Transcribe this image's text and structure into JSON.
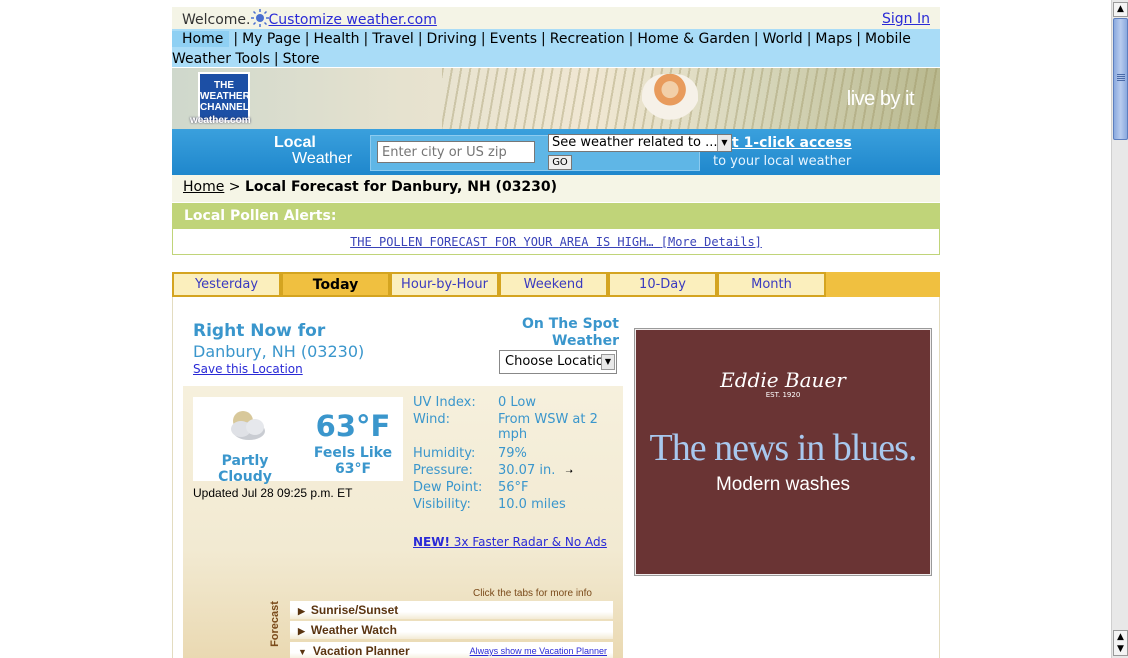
{
  "welcome": {
    "text": "Welcome.",
    "customize_link": "Customize weather.com",
    "sign_in": "Sign In"
  },
  "nav": {
    "row1": [
      "Home",
      "My Page",
      "Health",
      "Travel",
      "Driving",
      "Events",
      "Recreation",
      "Home & Garden",
      "World",
      "Maps",
      "Mobile"
    ],
    "row2": [
      "Weather Tools",
      "Store"
    ]
  },
  "banner": {
    "logo_lines": [
      "THE",
      "WEATHER",
      "CHANNEL"
    ],
    "logo_caption": "weather.com",
    "tagline": "live by it"
  },
  "local": {
    "title": "Local",
    "title2": "Weather",
    "city_placeholder": "Enter city or US zip",
    "related_select": "See weather related to ...",
    "go": "GO",
    "access_link": "t 1-click access",
    "access_sub": "to your local weather"
  },
  "breadcrumb": {
    "home": "Home",
    "sep": " > ",
    "current": "Local Forecast for Danbury, NH (03230)"
  },
  "pollen": {
    "heading": "Local Pollen Alerts:",
    "alert": "THE POLLEN FORECAST FOR YOUR AREA IS HIGH…",
    "more": "[More Details]"
  },
  "tabs": [
    "Yesterday",
    "Today",
    "Hour-by-Hour",
    "Weekend",
    "10-Day",
    "Month"
  ],
  "active_tab": "Today",
  "right_now": {
    "title": "Right Now for",
    "location": "Danbury, NH (03230)",
    "save": "Save this Location",
    "spot_title": "On The Spot Weather",
    "spot_select": "Choose Locatio",
    "condition": "Partly Cloudy",
    "temp": "63°F",
    "feels_like_label": "Feels Like",
    "feels_like": "63°F",
    "updated": "Updated Jul 28 09:25 p.m. ET",
    "details": [
      {
        "k": "UV Index:",
        "v": "0 Low"
      },
      {
        "k": "Wind:",
        "v": "From WSW at 2 mph"
      },
      {
        "k": "Humidity:",
        "v": "79%"
      },
      {
        "k": "Pressure:",
        "v": "30.07 in."
      },
      {
        "k": "Dew Point:",
        "v": "56°F"
      },
      {
        "k": "Visibility:",
        "v": "10.0 miles"
      }
    ],
    "radar_new": "NEW!",
    "radar_text": " 3x Faster Radar & No Ads"
  },
  "forecast_tabs": {
    "hint": "Click the tabs for more info",
    "vertical_label": "Forecast",
    "items": [
      "Sunrise/Sunset",
      "Weather Watch",
      "Vacation Planner"
    ],
    "vacation_link": "Always show me Vacation Planner"
  },
  "ad": {
    "brand": "Eddie Bauer",
    "est": "EST. 1920",
    "headline": "The news in blues.",
    "sub": "Modern washes",
    "bg_color": "#6a3434"
  }
}
